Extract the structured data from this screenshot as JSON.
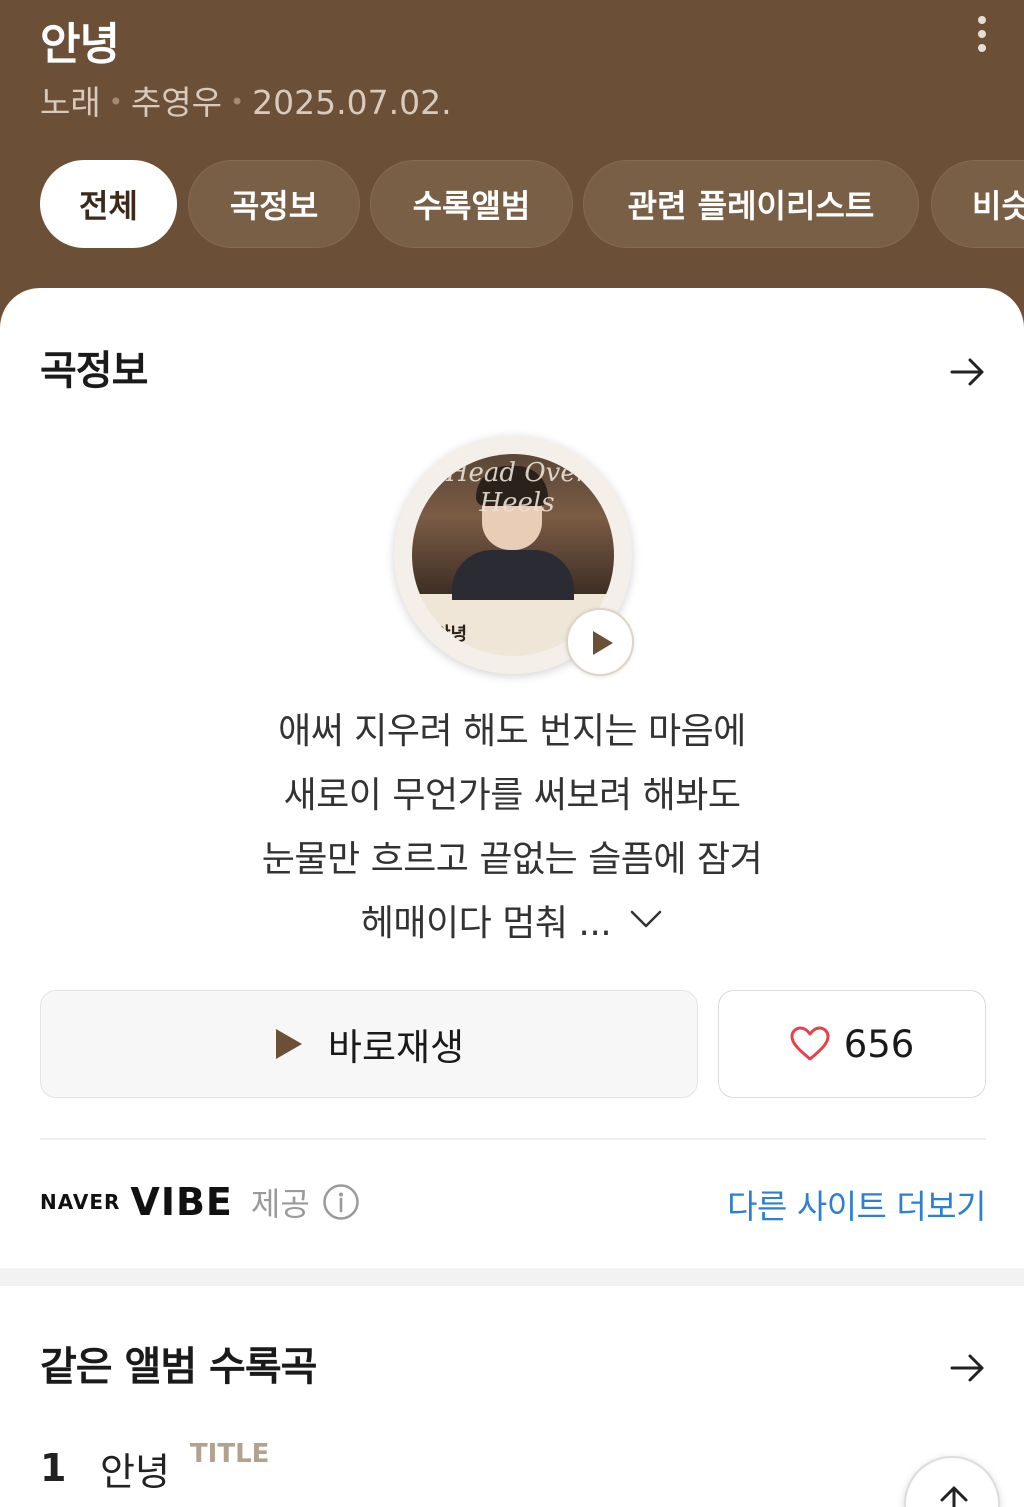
{
  "header": {
    "title": "안녕",
    "meta": {
      "type": "노래",
      "artist": "추영우",
      "date": "2025.07.02."
    }
  },
  "tabs": [
    {
      "label": "전체",
      "active": true
    },
    {
      "label": "곡정보",
      "active": false
    },
    {
      "label": "수록앨범",
      "active": false
    },
    {
      "label": "관련 플레이리스트",
      "active": false
    },
    {
      "label": "비슷",
      "active": false
    }
  ],
  "song_info": {
    "section_title": "곡정보",
    "cover_text": {
      "script": "Head Over Heels",
      "name": "안녕"
    },
    "lyrics": [
      "애써 지우려 해도 번지는 마음에",
      "새로이 무언가를 써보려 해봐도",
      "눈물만 흐르고 끝없는 슬픔에 잠겨",
      "헤매이다 멈춰 ..."
    ],
    "play_button_label": "바로재생",
    "like_count": "656",
    "provider": {
      "naver": "NAVER",
      "vibe": "VIBE",
      "provided": "제공"
    },
    "more_sites_label": "다른 사이트 더보기"
  },
  "album_tracks": {
    "section_title": "같은 앨범 수록곡",
    "tracks": [
      {
        "number": "1",
        "title": "안녕",
        "badge": "TITLE"
      }
    ]
  },
  "colors": {
    "header_bg": "#6b4f37",
    "link_blue": "#2e7fd0",
    "heart_red": "#e8404a",
    "play_brown": "#6b4f37",
    "title_badge": "#b4a18e"
  },
  "icons": [
    "kebab-menu-icon",
    "arrow-right-icon",
    "play-icon",
    "chevron-down-icon",
    "heart-icon",
    "info-icon",
    "arrow-up-icon"
  ]
}
